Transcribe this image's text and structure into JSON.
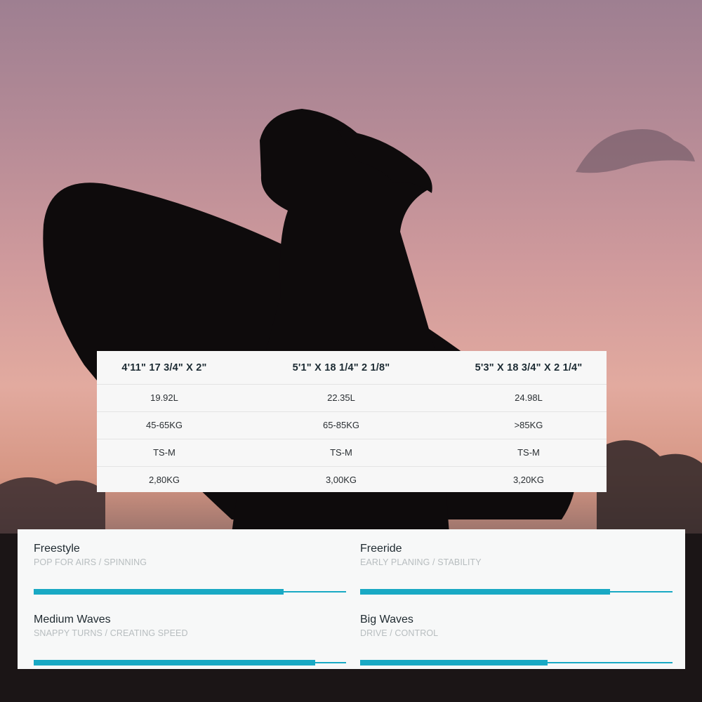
{
  "specs": {
    "sizes": [
      "4'11\" 17 3/4\" X 2\"",
      "5'1\" X 18 1/4\" 2 1/8\"",
      "5'3\" X 18 3/4\" X 2 1/4\""
    ],
    "rows": [
      [
        "19.92L",
        "22.35L",
        "24.98L"
      ],
      [
        "45-65KG",
        "65-85KG",
        ">85KG"
      ],
      [
        "TS-M",
        "TS-M",
        "TS-M"
      ],
      [
        "2,80KG",
        "3,00KG",
        "3,20KG"
      ]
    ]
  },
  "ratings": [
    {
      "name": "Freestyle",
      "subtitle": "POP FOR AIRS / SPINNING",
      "level": 0.8
    },
    {
      "name": "Freeride",
      "subtitle": "EARLY PLANING / STABILITY",
      "level": 0.8
    },
    {
      "name": "Medium Waves",
      "subtitle": "SNAPPY TURNS / CREATING SPEED",
      "level": 0.9
    },
    {
      "name": "Big Waves",
      "subtitle": "DRIVE / CONTROL",
      "level": 0.6
    }
  ],
  "colors": {
    "accent": "#19a9c4"
  }
}
